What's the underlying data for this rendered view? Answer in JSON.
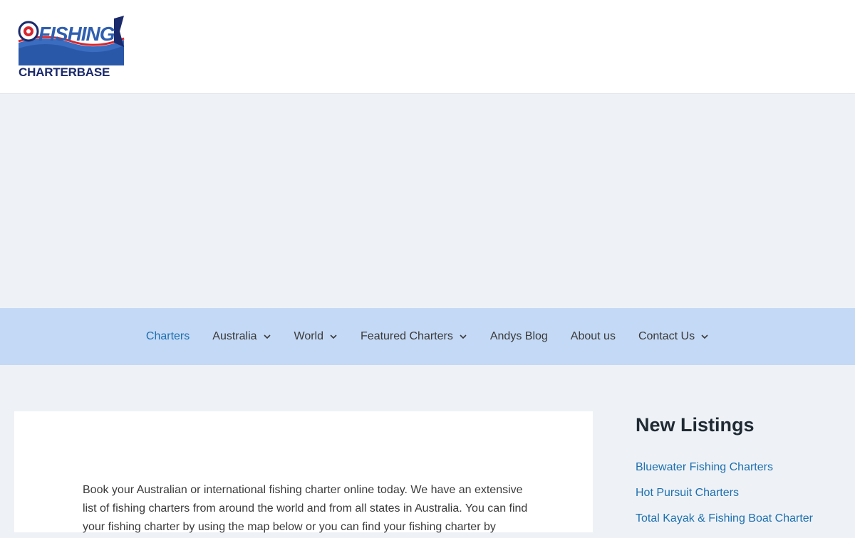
{
  "logo": {
    "top_word": "FISHING",
    "bottom_word": "CHARTERBASE",
    "colors": {
      "navy": "#1b2a6b",
      "blue": "#2f5fb0",
      "red": "#d7262e"
    }
  },
  "nav": {
    "items": [
      {
        "label": "Charters",
        "has_dropdown": false,
        "active": true
      },
      {
        "label": "Australia",
        "has_dropdown": true,
        "active": false
      },
      {
        "label": "World",
        "has_dropdown": true,
        "active": false
      },
      {
        "label": "Featured Charters",
        "has_dropdown": true,
        "active": false
      },
      {
        "label": "Andys Blog",
        "has_dropdown": false,
        "active": false
      },
      {
        "label": "About us",
        "has_dropdown": false,
        "active": false
      },
      {
        "label": "Contact Us",
        "has_dropdown": true,
        "active": false
      }
    ]
  },
  "main": {
    "intro": "Book your Australian or international fishing charter online today. We have an extensive list of fishing charters from around the world and from all states in Australia. You can find your fishing charter by using the map below or you can find your fishing charter by"
  },
  "sidebar": {
    "heading": "New Listings",
    "listings": [
      "Bluewater Fishing Charters",
      "Hot Pursuit Charters",
      "Total Kayak & Fishing Boat Charter"
    ]
  },
  "colors": {
    "link": "#1e6fb0",
    "nav_bg": "#c4d9f5",
    "page_bg": "#eef2f6"
  }
}
